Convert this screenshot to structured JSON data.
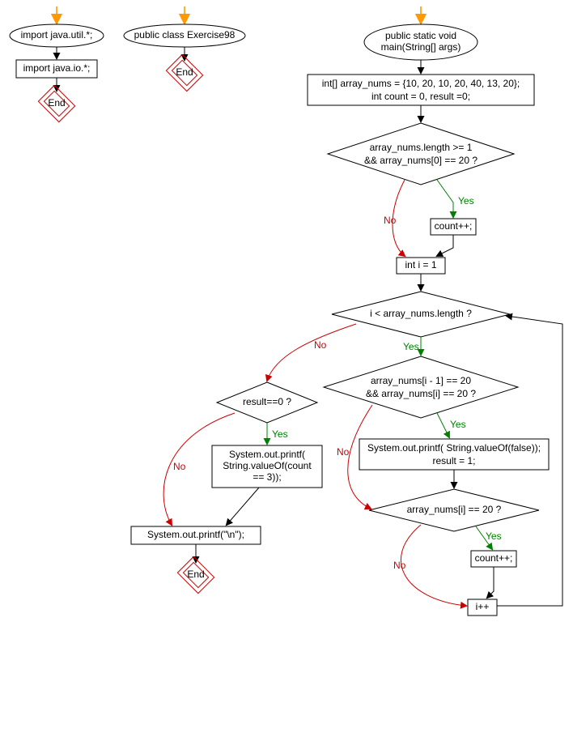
{
  "flow1": {
    "start": "import java.util.*;",
    "step1": "import java.io.*;",
    "end": "End"
  },
  "flow2": {
    "start": "public class Exercise98",
    "end": "End"
  },
  "flow3": {
    "start_l1": "public static void",
    "start_l2": "main(String[] args)",
    "init_l1": "int[] array_nums = {10, 20, 10, 20, 40, 13, 20};",
    "init_l2": "int count = 0, result =0;",
    "cond1_l1": "array_nums.length >= 1",
    "cond1_l2": "&& array_nums[0] == 20 ?",
    "count_inc": "count++;",
    "init_i": "int i = 1",
    "loop_cond": "i < array_nums.length ?",
    "result_cond": "result==0 ?",
    "print_count_l1": "System.out.printf(",
    "print_count_l2": "String.valueOf(count",
    "print_count_l3": "== 3));",
    "print_nl": "System.out.printf(\"\\n\");",
    "end": "End",
    "pair_cond_l1": "array_nums[i - 1] == 20",
    "pair_cond_l2": "&& array_nums[i] == 20 ?",
    "print_false_l1": "System.out.printf( String.valueOf(false));",
    "print_false_l2": "result = 1;",
    "eq20_cond": "array_nums[i] == 20 ?",
    "count_inc2": "count++;",
    "i_inc": "i++",
    "yes": "Yes",
    "no": "No"
  }
}
